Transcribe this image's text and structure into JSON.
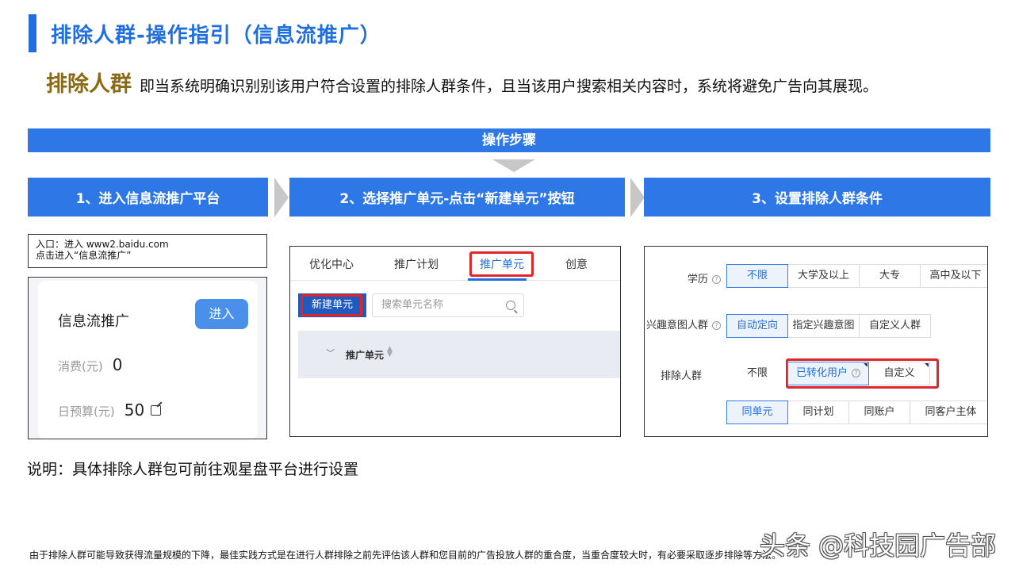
{
  "header": {
    "title": "排除人群-操作指引（信息流推广）",
    "definition_term": "排除人群",
    "definition_text": "即当系统明确识别别该用户符合设置的排除人群条件，且当该用户搜索相关内容时，系统将避免广告向其展现。"
  },
  "steps": {
    "banner": "操作步骤",
    "step1": "1、进入信息流推广平台",
    "step2": "2、选择推广单元-点击“新建单元”按钮",
    "step3": "3、设置排除人群条件"
  },
  "panel1": {
    "entry_line1": "入口：进入 www2.baidu.com",
    "entry_line2": "点击进入“信息流推广”",
    "card_title": "信息流推广",
    "enter_button": "进入",
    "spend_label": "消费(元)",
    "spend_value": "0",
    "budget_label": "日预算(元)",
    "budget_value": "50"
  },
  "panel2": {
    "tabs": [
      "优化中心",
      "推广计划",
      "推广单元",
      "创意"
    ],
    "active_tab": "推广单元",
    "new_unit_button": "新建单元",
    "search_placeholder": "搜索单元名称",
    "column_header": "推广单元"
  },
  "panel3": {
    "education": {
      "label": "学历",
      "options": [
        "不限",
        "大学及以上",
        "大专",
        "高中及以下"
      ],
      "selected": "不限"
    },
    "interest": {
      "label": "兴趣意图人群",
      "options": [
        "自动定向",
        "指定兴趣意图",
        "自定义人群"
      ],
      "selected": "自动定向"
    },
    "exclude": {
      "label": "排除人群",
      "options": [
        "不限",
        "已转化用户",
        "自定义"
      ],
      "selected": "已转化用户"
    },
    "scope": {
      "options": [
        "同单元",
        "同计划",
        "同账户",
        "同客户主体"
      ],
      "selected": "同单元"
    }
  },
  "footer": {
    "note": "说明：具体排除人群包可前往观星盘平台进行设置",
    "footnote": "由于排除人群可能导致获得流量规模的下降，最佳实践方式是在进行人群排除之前先评估该人群和您目前的广告投放人群的重合度，当重合度较大时，有必要采取逐步排除等方法。",
    "watermark": "头条 @科技园广告部"
  },
  "colors": {
    "primary": "#2d78e6",
    "title": "#1f6fe0",
    "term": "#8a6a12",
    "highlight": "#e0262b"
  }
}
